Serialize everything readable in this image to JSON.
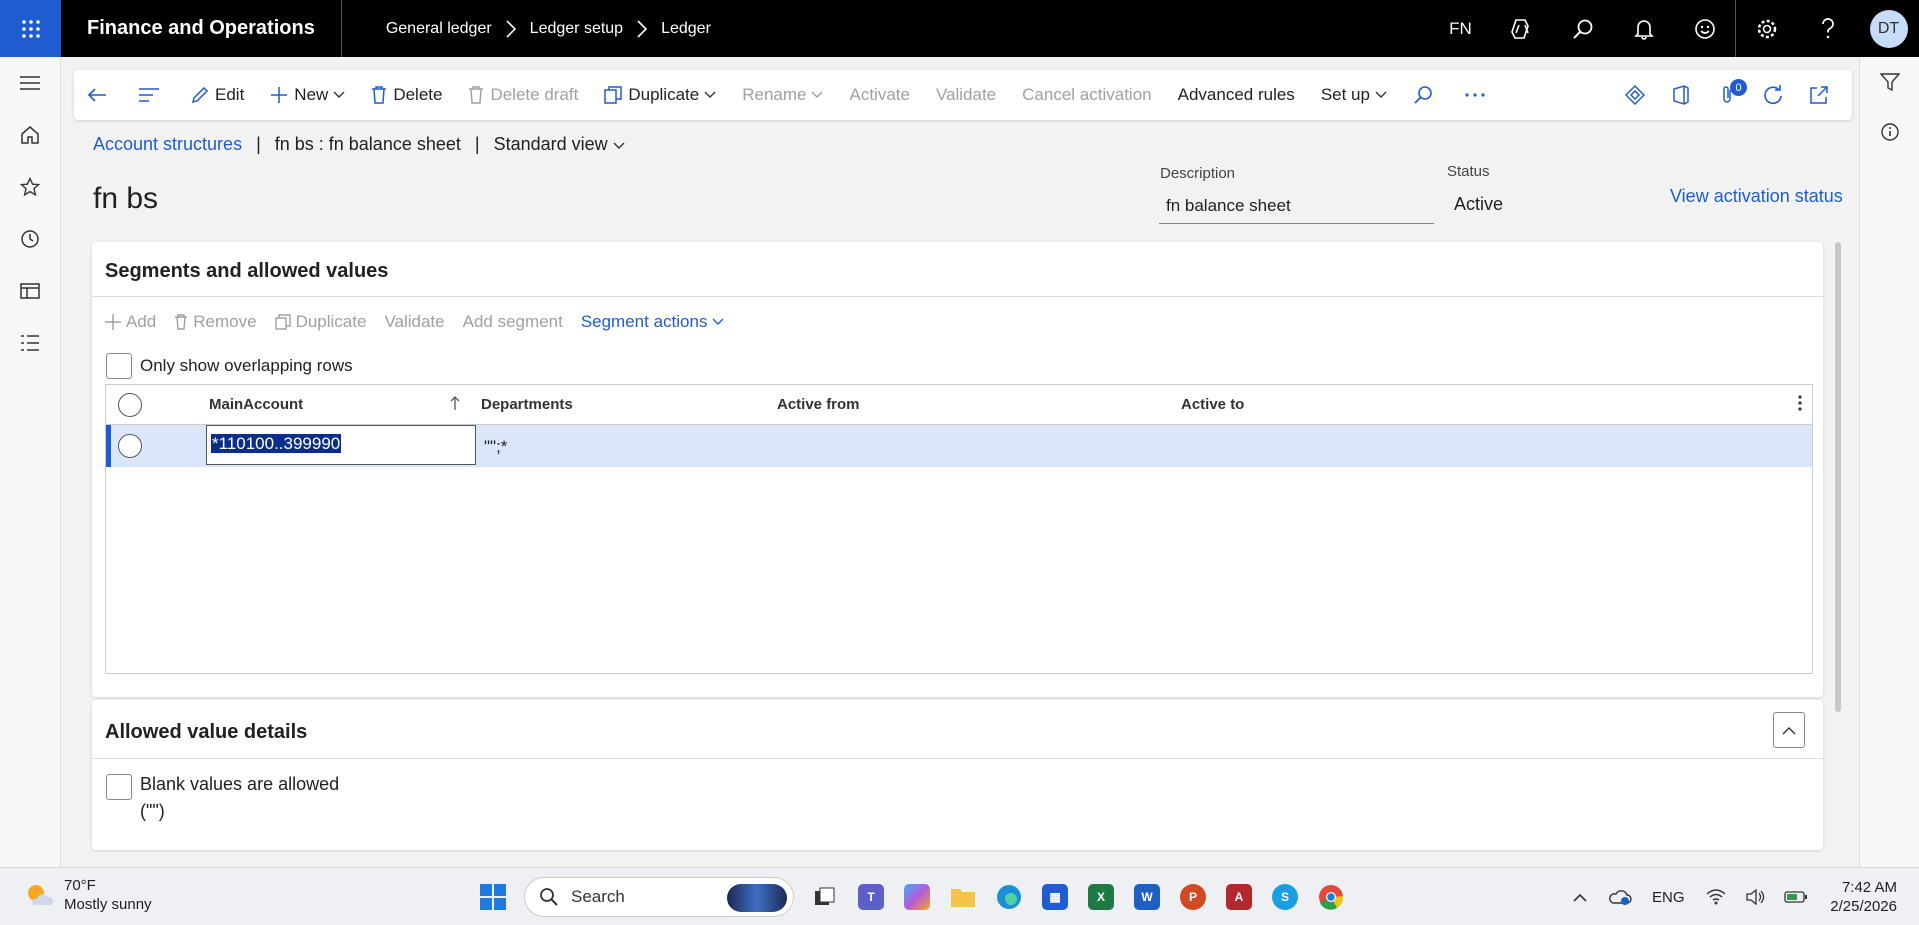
{
  "app": {
    "title": "Finance and Operations",
    "breadcrumbs": [
      "General ledger",
      "Ledger setup",
      "Ledger"
    ],
    "company": "FN",
    "avatar_initials": "DT",
    "accent_color": "#1f5cd1"
  },
  "action_pane": {
    "edit": "Edit",
    "new": "New",
    "delete": "Delete",
    "delete_draft": "Delete draft",
    "duplicate": "Duplicate",
    "rename": "Rename",
    "activate": "Activate",
    "validate": "Validate",
    "cancel_activation": "Cancel activation",
    "advanced_rules": "Advanced rules",
    "set_up": "Set up",
    "attachments_count": "0"
  },
  "page": {
    "breadcrumb_link": "Account structures",
    "record_caption": "fn bs : fn balance sheet",
    "view_selector": "Standard view",
    "title": "fn bs",
    "description_label": "Description",
    "description_value": "fn balance sheet",
    "status_label": "Status",
    "status_value": "Active",
    "view_activation_link": "View activation status"
  },
  "segments": {
    "title": "Segments and allowed values",
    "toolbar": {
      "add": "Add",
      "remove": "Remove",
      "duplicate": "Duplicate",
      "validate": "Validate",
      "add_segment": "Add segment",
      "segment_actions": "Segment actions"
    },
    "overlap_checkbox": "Only show overlapping rows",
    "columns": [
      "MainAccount",
      "Departments",
      "Active from",
      "Active to"
    ],
    "rows": [
      {
        "main_account": "*110100..399990",
        "departments": "\"\";*",
        "active_from": "",
        "active_to": ""
      }
    ]
  },
  "details": {
    "title": "Allowed value details",
    "blank_checkbox_label": "Blank values are allowed",
    "blank_checkbox_sub": "(\"\")"
  },
  "taskbar": {
    "temperature": "70°F",
    "weather": "Mostly sunny",
    "search_placeholder": "Search",
    "language": "ENG",
    "time": "7:42 AM",
    "date": "2/25/2026"
  }
}
